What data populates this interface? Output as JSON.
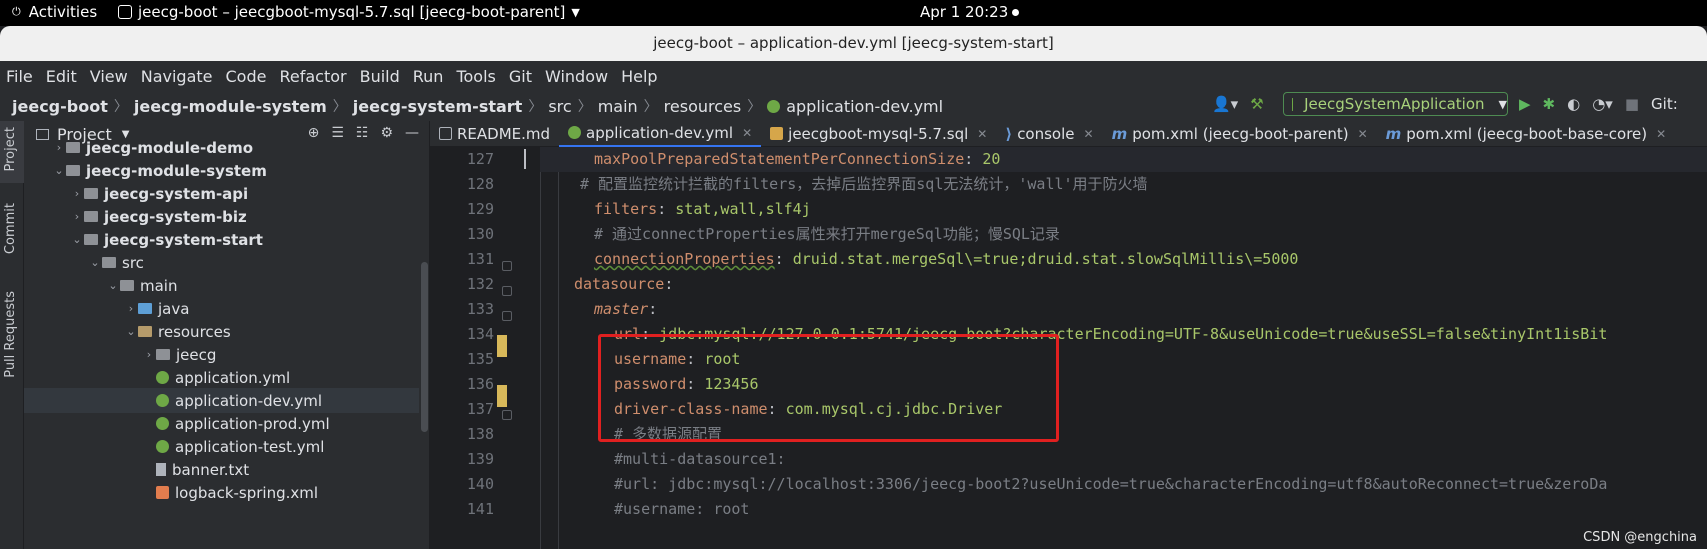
{
  "topbar": {
    "activities": "Activities",
    "app_title": "jeecg-boot – jeecgboot-mysql-5.7.sql [jeecg-boot-parent]",
    "clock": "Apr 1  20:23"
  },
  "window_title": "jeecg-boot – application-dev.yml [jeecg-system-start]",
  "menu": [
    "File",
    "Edit",
    "View",
    "Navigate",
    "Code",
    "Refactor",
    "Build",
    "Run",
    "Tools",
    "Git",
    "Window",
    "Help"
  ],
  "breadcrumb": [
    "jeecg-boot",
    "jeecg-module-system",
    "jeecg-system-start",
    "src",
    "main",
    "resources",
    "application-dev.yml"
  ],
  "run_config": "JeecgSystemApplication",
  "git_label": "Git:",
  "stripe": [
    "Project",
    "Commit",
    "Pull Requests"
  ],
  "project_panel": {
    "title": "Project",
    "rows": [
      {
        "label": "jeecg-module-demo",
        "bold": true
      },
      {
        "label": "jeecg-module-system",
        "bold": true
      },
      {
        "label": "jeecg-system-api",
        "bold": true
      },
      {
        "label": "jeecg-system-biz",
        "bold": true
      },
      {
        "label": "jeecg-system-start",
        "bold": true
      },
      {
        "label": "src"
      },
      {
        "label": "main"
      },
      {
        "label": "java"
      },
      {
        "label": "resources"
      },
      {
        "label": "jeecg"
      },
      {
        "label": "application.yml"
      },
      {
        "label": "application-dev.yml"
      },
      {
        "label": "application-prod.yml"
      },
      {
        "label": "application-test.yml"
      },
      {
        "label": "banner.txt"
      },
      {
        "label": "logback-spring.xml"
      }
    ]
  },
  "tabs": [
    {
      "label": "README.md"
    },
    {
      "label": "application-dev.yml"
    },
    {
      "label": "jeecgboot-mysql-5.7.sql"
    },
    {
      "label": "console"
    },
    {
      "label": "pom.xml (jeecg-boot-parent)"
    },
    {
      "label": "pom.xml (jeecg-boot-base-core)"
    }
  ],
  "line_numbers": [
    "127",
    "128",
    "129",
    "130",
    "131",
    "132",
    "133",
    "134",
    "135",
    "136",
    "137",
    "138",
    "139",
    "140",
    "141"
  ],
  "code": {
    "l127_key": "maxPoolPreparedStatementPerConnectionSize",
    "l127_val": "20",
    "l128": "# 配置监控统计拦截的filters，去掉后监控界面sql无法统计，'wall'用于防火墙",
    "l129_key": "filters",
    "l129_val": "stat,wall,slf4j",
    "l130": "# 通过connectProperties属性来打开mergeSql功能；慢SQL记录",
    "l131_key": "connectionProperties",
    "l131_val": "druid.stat.mergeSql\\=true;druid.stat.slowSqlMillis\\=5000",
    "l132_key": "datasource",
    "l133_key": "master",
    "l134_key": "url",
    "l134_val": "jdbc:mysql://127.0.0.1:5741/jeecg-boot?characterEncoding=UTF-8&useUnicode=true&useSSL=false&tinyInt1isBit",
    "l135_key": "username",
    "l135_val": "root",
    "l136_key": "password",
    "l136_val": "123456",
    "l137_key": "driver-class-name",
    "l137_val": "com.mysql.cj.jdbc.Driver",
    "l138": "# 多数据源配置",
    "l139": "#multi-datasource1:",
    "l140": "#url: jdbc:mysql://localhost:3306/jeecg-boot2?useUnicode=true&characterEncoding=utf8&autoReconnect=true&zeroDa",
    "l141": "#username: root"
  },
  "watermark": "CSDN @engchina"
}
